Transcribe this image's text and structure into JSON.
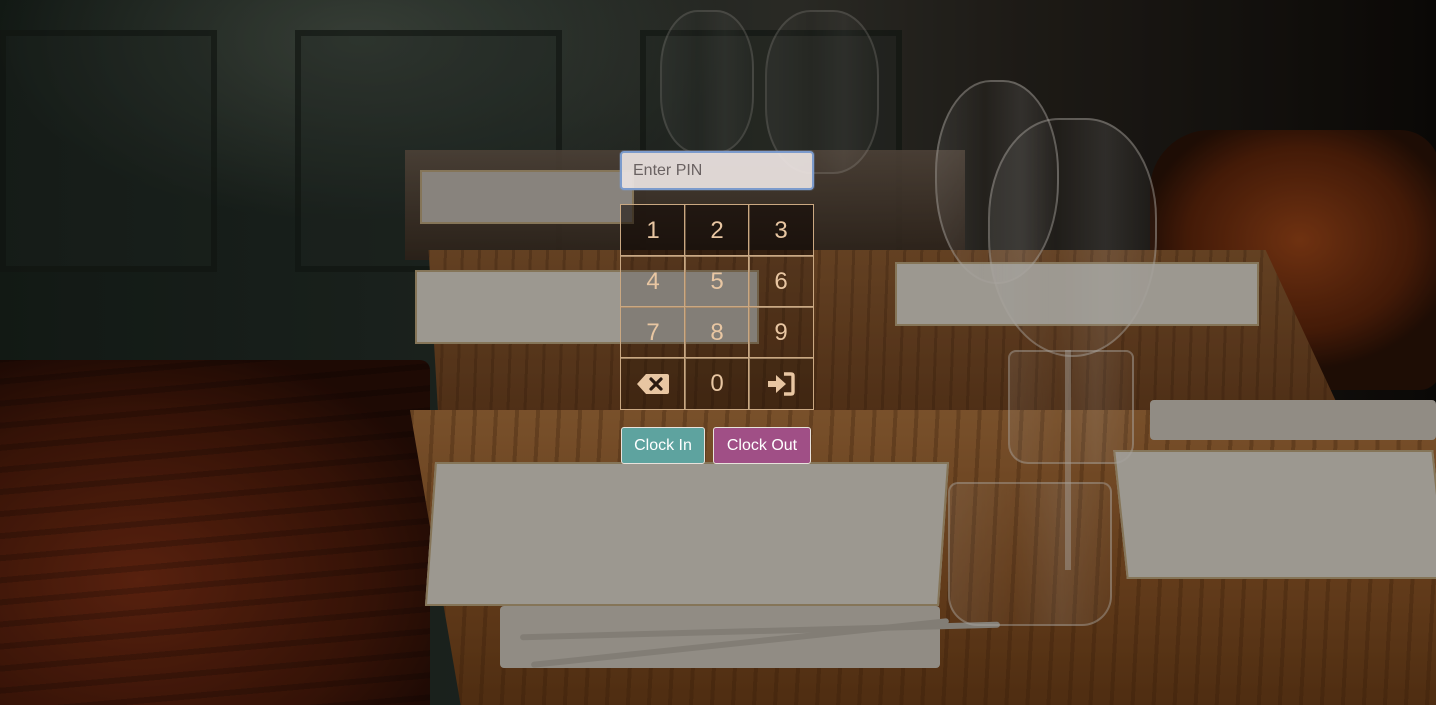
{
  "pin": {
    "placeholder": "Enter PIN",
    "value": ""
  },
  "keypad": {
    "keys": [
      "1",
      "2",
      "3",
      "4",
      "5",
      "6",
      "7",
      "8",
      "9",
      "0"
    ],
    "backspace_icon": "backspace-icon",
    "submit_icon": "sign-in-icon"
  },
  "actions": {
    "clock_in_label": "Clock In",
    "clock_out_label": "Clock Out"
  },
  "colors": {
    "key_border": "#caa882",
    "key_text": "#e8c6a2",
    "clock_in_bg": "#5ea39f",
    "clock_out_bg": "#a04f86",
    "input_focus_border": "#7c9bcc"
  }
}
